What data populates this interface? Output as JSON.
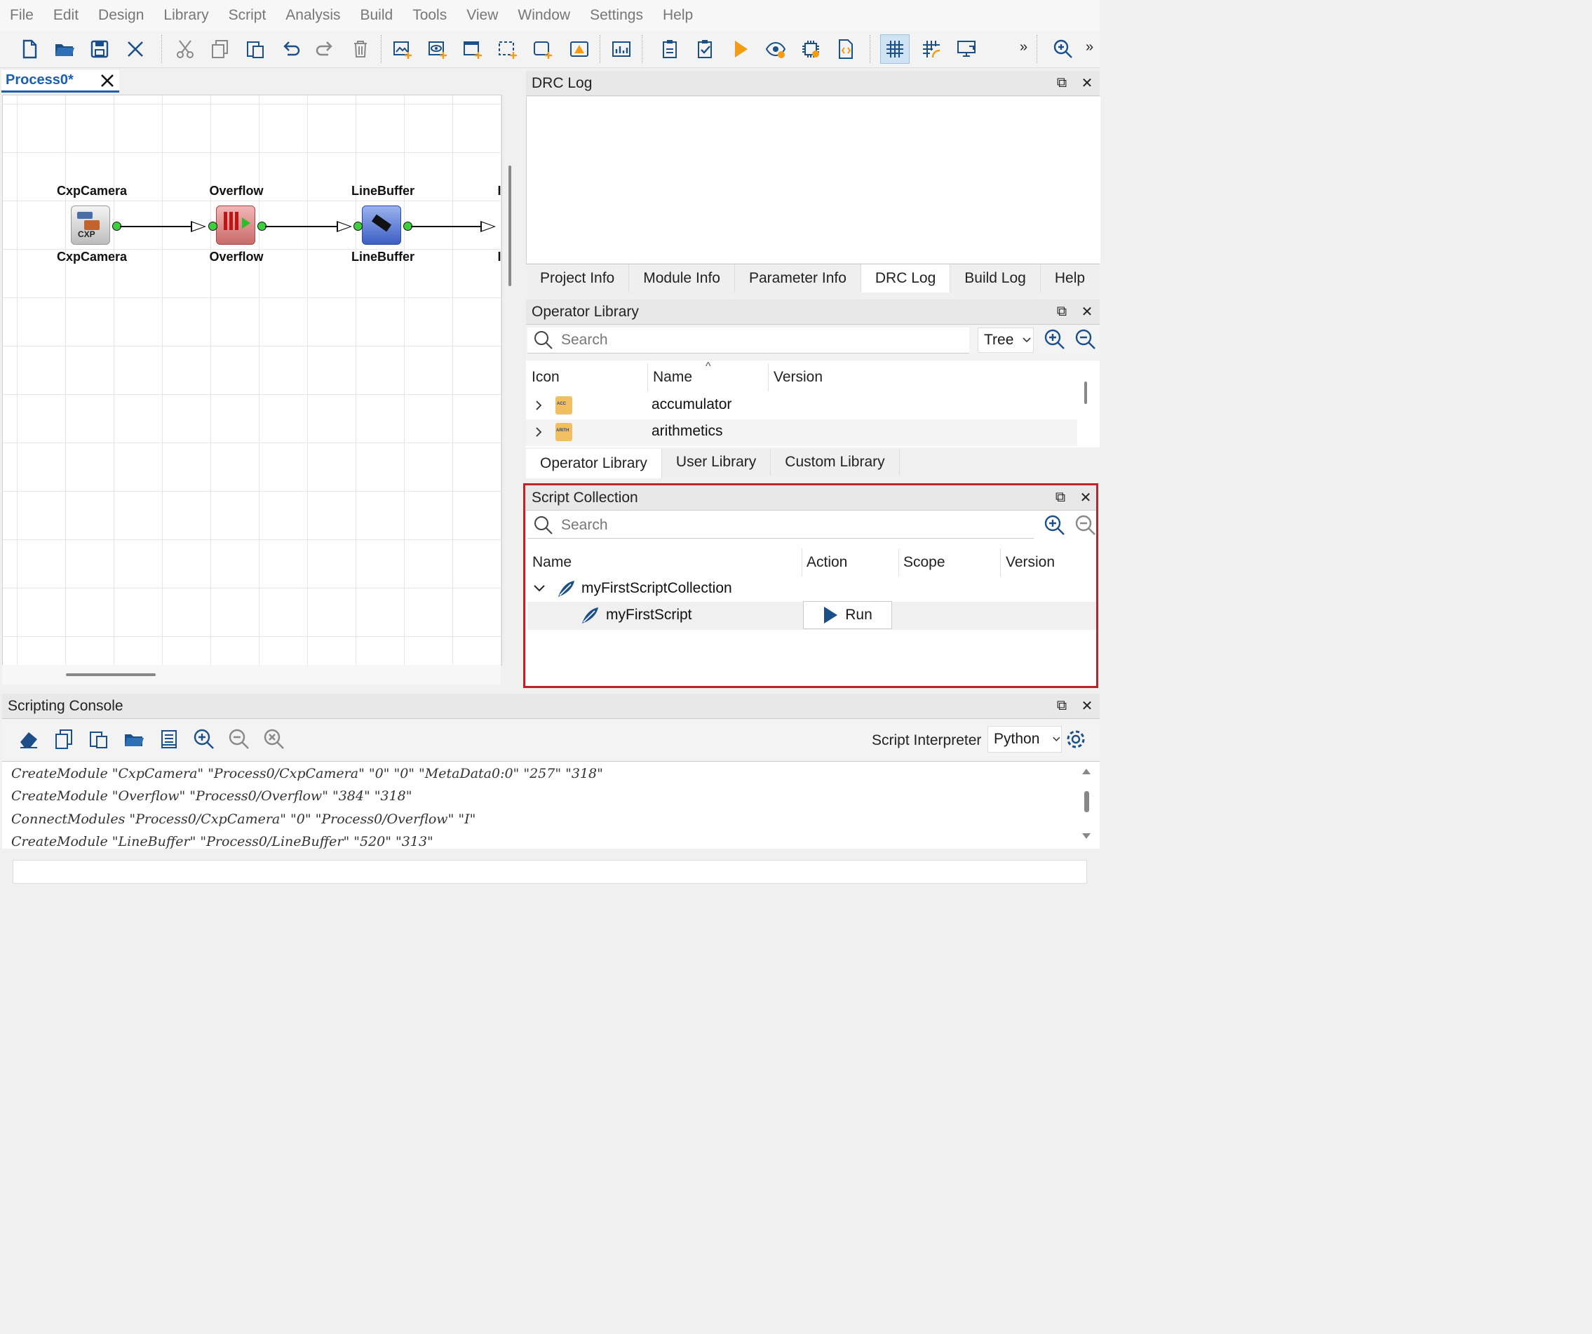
{
  "menu": [
    "File",
    "Edit",
    "Design",
    "Library",
    "Script",
    "Analysis",
    "Build",
    "Tools",
    "View",
    "Window",
    "Settings",
    "Help"
  ],
  "toolbar": {
    "overflow1": "»",
    "overflow2": "»",
    "icons": [
      "new-file-icon",
      "open-folder-icon",
      "save-icon",
      "close-icon",
      "cut-icon",
      "copy-icon",
      "paste-icon",
      "undo-icon",
      "redo-icon",
      "delete-icon",
      "add-image-icon",
      "add-view-icon",
      "add-window-icon",
      "add-selection-icon",
      "add-box-icon",
      "warning-icon",
      "chart-icon",
      "clipboard-icon",
      "clipboard-check-icon",
      "run-icon",
      "eye-icon",
      "chip-icon",
      "file-code-icon",
      "grid-icon",
      "grid-snap-icon",
      "display-icon",
      "zoom-in-icon"
    ]
  },
  "editor": {
    "tab_label": "Process0*",
    "modules": [
      {
        "name": "CxpCamera",
        "sublabel": "CxpCamera"
      },
      {
        "name": "Overflow",
        "sublabel": "Overflow"
      },
      {
        "name": "LineBuffer",
        "sublabel": "LineBuffer"
      },
      {
        "name": "I",
        "sublabel": "I"
      }
    ],
    "cxp_badge": "CXP"
  },
  "drc_panel": {
    "title": "DRC Log",
    "tabs": [
      "Project Info",
      "Module Info",
      "Parameter Info",
      "DRC Log",
      "Build Log",
      "Help"
    ],
    "active_tab": "DRC Log"
  },
  "operator_library": {
    "title": "Operator Library",
    "search_placeholder": "Search",
    "view_mode": "Tree",
    "columns": [
      "Icon",
      "Name",
      "Version"
    ],
    "sort_indicator": "^",
    "rows": [
      {
        "name": "accumulator",
        "badge": "ACC"
      },
      {
        "name": "arithmetics",
        "badge": "ARITH"
      }
    ],
    "tabs": [
      "Operator Library",
      "User Library",
      "Custom Library"
    ],
    "active_tab": "Operator Library"
  },
  "script_collection": {
    "title": "Script Collection",
    "search_placeholder": "Search",
    "columns": [
      "Name",
      "Action",
      "Scope",
      "Version"
    ],
    "collection_name": "myFirstScriptCollection",
    "script_name": "myFirstScript",
    "run_label": "Run"
  },
  "scripting_console": {
    "title": "Scripting Console",
    "interpreter_label": "Script Interpreter",
    "interpreter_value": "Python",
    "lines": [
      "CreateModule \"CxpCamera\" \"Process0/CxpCamera\" \"0\" \"0\" \"MetaData0:0\" \"257\" \"318\"",
      "CreateModule \"Overflow\" \"Process0/Overflow\" \"384\" \"318\"",
      "ConnectModules \"Process0/CxpCamera\" \"0\" \"Process0/Overflow\" \"I\"",
      "CreateModule \"LineBuffer\" \"Process0/LineBuffer\" \"520\" \"313\""
    ]
  },
  "colors": {
    "accent": "#1a5fb4",
    "highlight_border": "#c0222a",
    "port_green": "#3dd03d",
    "run_orange": "#f39c12"
  }
}
